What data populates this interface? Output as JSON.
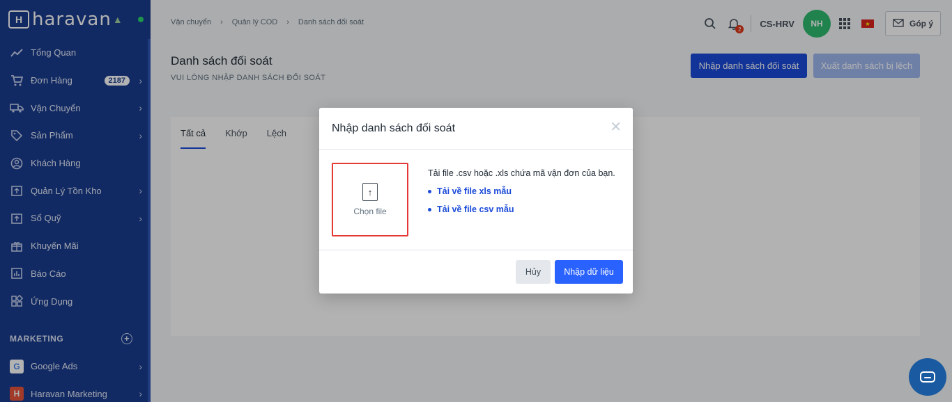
{
  "app": {
    "logo_text": "haravan"
  },
  "sidebar": {
    "items": [
      {
        "label": "Tổng Quan",
        "icon": "trend-icon",
        "has_chevron": false
      },
      {
        "label": "Đơn Hàng",
        "icon": "cart-icon",
        "badge": "2187",
        "has_chevron": true
      },
      {
        "label": "Vận Chuyển",
        "icon": "truck-icon",
        "has_chevron": true
      },
      {
        "label": "Sản Phẩm",
        "icon": "tag-icon",
        "has_chevron": true
      },
      {
        "label": "Khách Hàng",
        "icon": "user-circle-icon",
        "has_chevron": false
      },
      {
        "label": "Quản Lý Tồn Kho",
        "icon": "box-upload-icon",
        "has_chevron": true
      },
      {
        "label": "Sổ Quỹ",
        "icon": "cash-icon",
        "has_chevron": true
      },
      {
        "label": "Khuyến Mãi",
        "icon": "gift-icon",
        "has_chevron": false
      },
      {
        "label": "Báo Cáo",
        "icon": "report-icon",
        "has_chevron": false
      },
      {
        "label": "Ứng Dụng",
        "icon": "apps-icon",
        "has_chevron": false
      }
    ],
    "marketing_title": "MARKETING",
    "marketing_items": [
      {
        "label": "Google Ads",
        "icon": "google-icon"
      },
      {
        "label": "Haravan Marketing",
        "icon": "haravan-marketing-icon"
      }
    ]
  },
  "header": {
    "breadcrumb": [
      "Vận chuyển",
      "Quản lý COD",
      "Danh sách đối soát"
    ],
    "notification_count": "2",
    "shop_name": "CS-HRV",
    "avatar_initials": "NH",
    "feedback_label": "Góp ý"
  },
  "page": {
    "title": "Danh sách đối soát",
    "subtitle": "VUI LÒNG NHẬP DANH SÁCH ĐỐI SOÁT",
    "import_button": "Nhập danh sách đối soát",
    "export_button": "Xuất danh sách bị lệch",
    "tabs": [
      "Tất cả",
      "Khớp",
      "Lệch"
    ]
  },
  "modal": {
    "title": "Nhập danh sách đối soát",
    "choose_file": "Chọn file",
    "description": "Tải file .csv hoặc .xls chứa mã vận đơn của bạn.",
    "link_xls": "Tải về file xls mẫu",
    "link_csv": "Tải về file csv mẫu",
    "cancel": "Hủy",
    "submit": "Nhập dữ liệu"
  },
  "colors": {
    "sidebar_bg": "#1b3d8f",
    "primary": "#1a4ad8",
    "highlight_border": "#e53935",
    "avatar_bg": "#2fbb6f"
  }
}
